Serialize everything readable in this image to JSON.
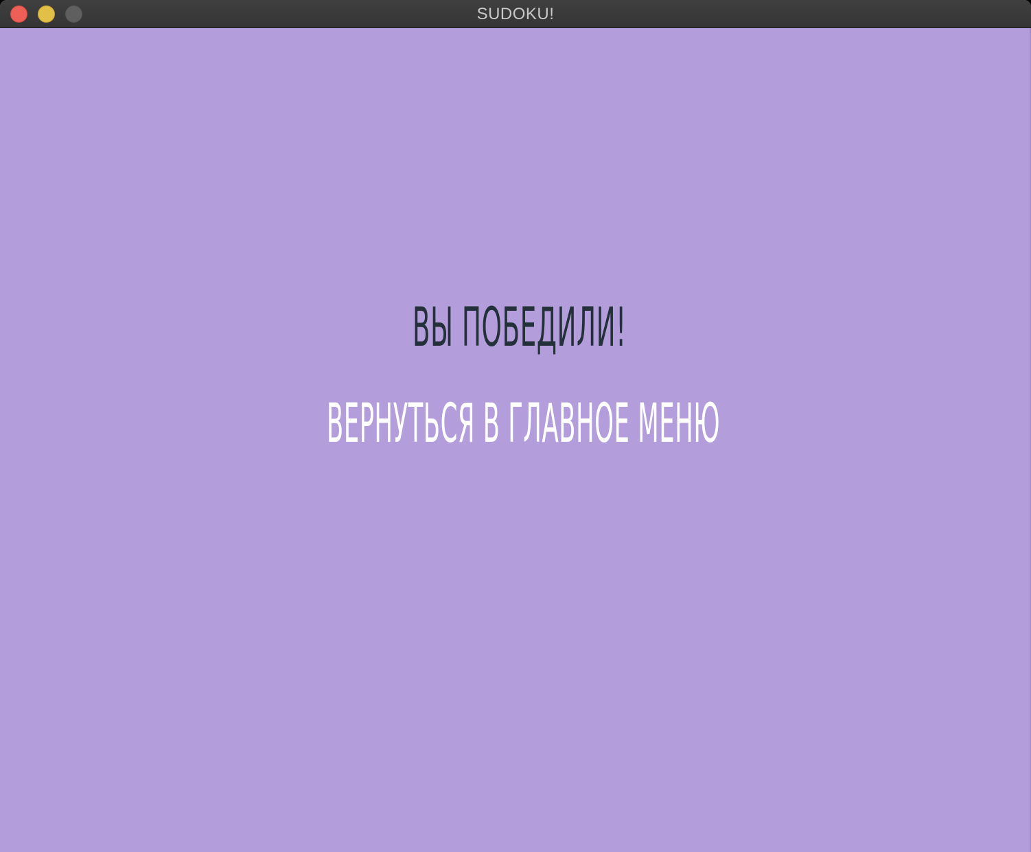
{
  "window": {
    "title": "SUDOKU!"
  },
  "screen": {
    "message": "ВЫ ПОБЕДИЛИ!",
    "back_to_menu_label": "ВЕРНУТЬСЯ В ГЛАВНОЕ МЕНЮ"
  },
  "colors": {
    "background": "#b39edb",
    "message_text": "#24313a",
    "button_text": "#ffffff",
    "titlebar": "#3a3a3a"
  },
  "icons": {
    "close": "close-icon",
    "minimize": "minimize-icon",
    "zoom": "zoom-icon"
  }
}
